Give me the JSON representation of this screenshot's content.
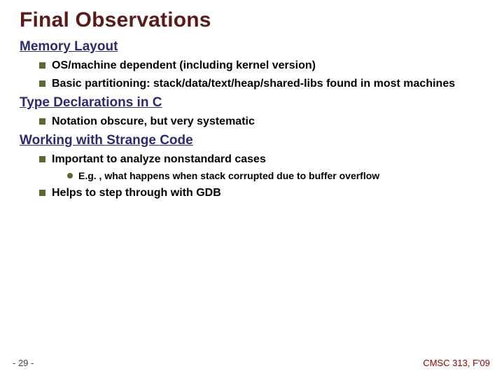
{
  "title": "Final Observations",
  "sections": [
    {
      "heading": "Memory Layout",
      "bullets": [
        {
          "text": "OS/machine dependent (including kernel version)"
        },
        {
          "text": "Basic partitioning: stack/data/text/heap/shared-libs found in most machines"
        }
      ]
    },
    {
      "heading": "Type Declarations in C",
      "bullets": [
        {
          "text": "Notation obscure, but very systematic"
        }
      ]
    },
    {
      "heading": "Working with Strange Code",
      "bullets": [
        {
          "text": "Important to analyze nonstandard cases",
          "sub": [
            "E.g. , what happens when stack corrupted due to buffer overflow"
          ]
        },
        {
          "text": "Helps to step through with GDB"
        }
      ]
    }
  ],
  "footer": {
    "page": "- 29 -",
    "course": "CMSC 313, F'09"
  }
}
